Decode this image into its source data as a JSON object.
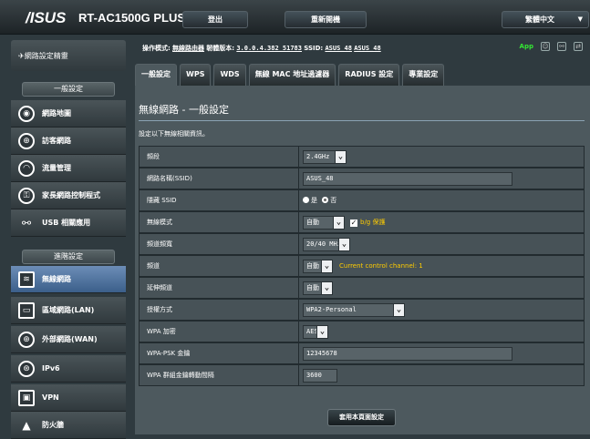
{
  "header": {
    "logo": "/ISUS",
    "model": "RT-AC1500G PLUS",
    "logout": "登出",
    "reboot": "重新開機",
    "language": "繁體中文"
  },
  "infobar": {
    "mode_label": "操作模式:",
    "mode_value": "無線路由器",
    "fw_label": "韌體版本:",
    "fw_value": "3.0.0.4.382_51783",
    "ssid_label": "SSID:",
    "ssid_1": "ASUS_48",
    "ssid_2": "ASUS_48",
    "app": "App"
  },
  "sidebar": {
    "top_item": "網路設定精靈",
    "general_header": "一般設定",
    "general_items": [
      "網路地圖",
      "訪客網路",
      "流量管理",
      "家長網路控制程式",
      "USB 相關應用"
    ],
    "advanced_header": "進階設定",
    "advanced_items": [
      "無線網路",
      "區域網路(LAN)",
      "外部網路(WAN)",
      "IPv6",
      "VPN",
      "防火牆"
    ]
  },
  "tabs": [
    "一般設定",
    "WPS",
    "WDS",
    "無線 MAC 地址過濾器",
    "RADIUS 設定",
    "專業設定"
  ],
  "panel": {
    "title": "無線網路 - 一般設定",
    "desc": "設定以下無線相關資訊。",
    "apply": "套用本頁面設定"
  },
  "fields": {
    "band": {
      "label": "頻段",
      "value": "2.4GHz"
    },
    "ssid": {
      "label": "網路名稱(SSID)",
      "value": "ASUS_48"
    },
    "hide_ssid": {
      "label": "隱藏 SSID",
      "yes": "是",
      "no": "否"
    },
    "mode": {
      "label": "無線模式",
      "value": "自動",
      "check": "b/g 保護"
    },
    "bandwidth": {
      "label": "頻道頻寬",
      "value": "20/40 MHz"
    },
    "channel": {
      "label": "頻道",
      "value": "自動",
      "note": "Current control channel: 1"
    },
    "ext_channel": {
      "label": "延伸頻道",
      "value": "自動"
    },
    "auth": {
      "label": "授權方式",
      "value": "WPA2-Personal"
    },
    "wpa_enc": {
      "label": "WPA 加密",
      "value": "AES"
    },
    "psk": {
      "label": "WPA-PSK 金鑰",
      "value": "12345678"
    },
    "rotation": {
      "label": "WPA 群組金鑰轉動間隔",
      "value": "3600"
    }
  }
}
